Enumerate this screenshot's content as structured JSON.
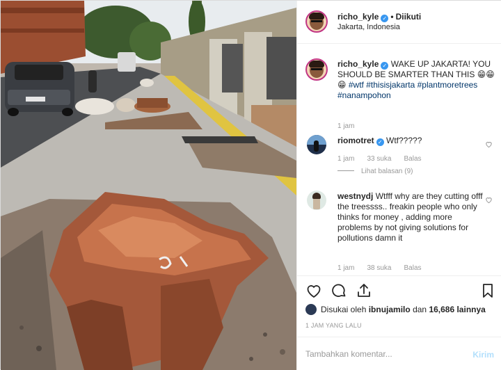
{
  "post": {
    "username": "richo_kyle",
    "separator": "•",
    "follow_label": "Diikuti",
    "location": "Jakarta, Indonesia",
    "verified_icon": "verified-badge-icon"
  },
  "caption": {
    "username": "richo_kyle",
    "text": "WAKE UP JAKARTA! YOU SHOULD BE SMARTER THAN THIS 😁😁😁",
    "hashtags": [
      "#wtf",
      "#thisisjakarta",
      "#plantmoretrees",
      "#nanampohon"
    ],
    "time": "1 jam"
  },
  "comments": [
    {
      "username": "riomotret",
      "text": "Wtf?????",
      "time": "1 jam",
      "likes": "33 suka",
      "reply_label": "Balas",
      "view_replies": "Lihat balasan (9)"
    },
    {
      "username": "westnydj",
      "text": "Wtfff why are they cutting offf the treessss.. freakin people who only thinks for money , adding more problems by not giving solutions for pollutions damn it",
      "time": "1 jam",
      "likes": "38 suka",
      "reply_label": "Balas"
    }
  ],
  "likes": {
    "prefix": "Disukai oleh",
    "user": "ibnujamilo",
    "conj": "dan",
    "count": "16,686 lainnya"
  },
  "timestamp": "1 JAM YANG LALU",
  "add_comment": {
    "placeholder": "Tambahkan komentar...",
    "post_label": "Kirim"
  },
  "colors": {
    "link": "#003569",
    "verified": "#3897f0",
    "muted": "#999999",
    "post_disabled": "#b2dffc"
  },
  "icons": [
    "heart-icon",
    "comment-icon",
    "share-icon",
    "bookmark-icon",
    "small-heart-icon"
  ]
}
